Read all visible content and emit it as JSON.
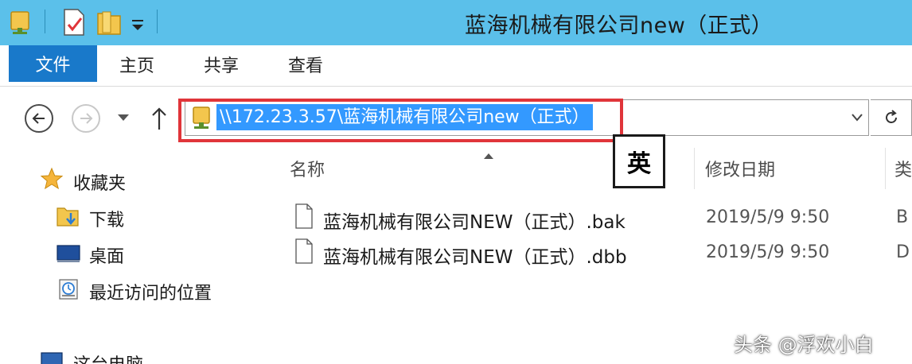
{
  "window": {
    "title": "蓝海机械有限公司new（正式）"
  },
  "ribbon": {
    "tabs": [
      {
        "label": "文件"
      },
      {
        "label": "主页"
      },
      {
        "label": "共享"
      },
      {
        "label": "查看"
      }
    ]
  },
  "address": {
    "path": "\\\\172.23.3.57\\蓝海机械有限公司new（正式）"
  },
  "ime_indicator": "英",
  "nav_pane": {
    "favorites_label": "收藏夹",
    "items": [
      {
        "label": "下载",
        "icon": "download-folder-icon"
      },
      {
        "label": "桌面",
        "icon": "desktop-icon"
      },
      {
        "label": "最近访问的位置",
        "icon": "recent-places-icon"
      }
    ],
    "this_pc_label": "这台电脑"
  },
  "columns": {
    "name": "名称",
    "date_modified": "修改日期",
    "type": "类"
  },
  "files": [
    {
      "name": "蓝海机械有限公司NEW（正式）.bak",
      "date": "2019/5/9 9:50",
      "type": "B"
    },
    {
      "name": "蓝海机械有限公司NEW（正式）.dbb",
      "date": "2019/5/9 9:50",
      "type": "D"
    }
  ],
  "watermark": "头条 @浮欢小白",
  "colors": {
    "titlebar": "#5bc0ea",
    "file_tab": "#1979ca",
    "selection": "#3399ff",
    "highlight_frame": "#e0353a"
  }
}
